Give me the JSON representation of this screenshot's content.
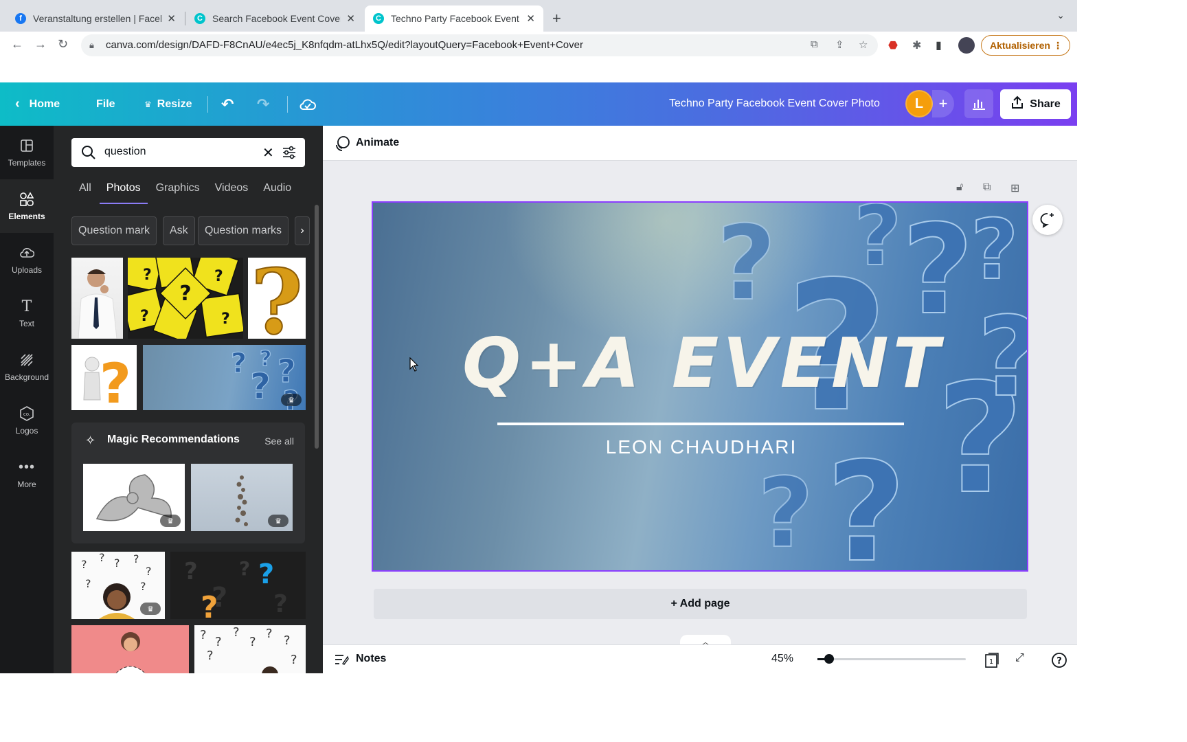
{
  "browser": {
    "tabs": [
      {
        "title": "Veranstaltung erstellen | Faceb",
        "favicon": "facebook-icon",
        "color": "#1877f2"
      },
      {
        "title": "Search Facebook Event Cover",
        "favicon": "canva-icon",
        "color": "#00c4cc"
      },
      {
        "title": "Techno Party Facebook Event C",
        "favicon": "canva-icon",
        "color": "#00c4cc"
      }
    ],
    "url": "canva.com/design/DAFD-F8CnAU/e4ec5j_K8nfqdm-atLhx5Q/edit?layoutQuery=Facebook+Event+Cover",
    "update_label": "Aktualisieren"
  },
  "header": {
    "home": "Home",
    "file": "File",
    "resize": "Resize",
    "doc_title": "Techno Party Facebook Event Cover Photo",
    "avatar_letter": "L",
    "share": "Share",
    "gradient_start": "#0ebcc7",
    "gradient_end": "#7a3ff0"
  },
  "rail": {
    "items": [
      {
        "label": "Templates",
        "icon": "templates-icon"
      },
      {
        "label": "Elements",
        "icon": "elements-icon"
      },
      {
        "label": "Uploads",
        "icon": "upload-cloud-icon"
      },
      {
        "label": "Text",
        "icon": "text-icon"
      },
      {
        "label": "Background",
        "icon": "background-icon"
      },
      {
        "label": "Logos",
        "icon": "logos-icon"
      },
      {
        "label": "More",
        "icon": "more-dots-icon"
      }
    ]
  },
  "panel": {
    "search_value": "question",
    "tabs": [
      "All",
      "Photos",
      "Graphics",
      "Videos",
      "Audio"
    ],
    "active_tab": "Photos",
    "chips": [
      "Question mark",
      "Ask",
      "Question marks"
    ],
    "magic_title": "Magic Recommendations",
    "see_all": "See all"
  },
  "canvas": {
    "animate": "Animate",
    "design_title": "Q+A EVENT",
    "design_subtitle": "LEON CHAUDHARI",
    "add_page": "+ Add page",
    "notes": "Notes",
    "zoom": "45%",
    "zoom_fraction": 0.08,
    "page_number": "1",
    "selection_color": "#8b3dff"
  }
}
